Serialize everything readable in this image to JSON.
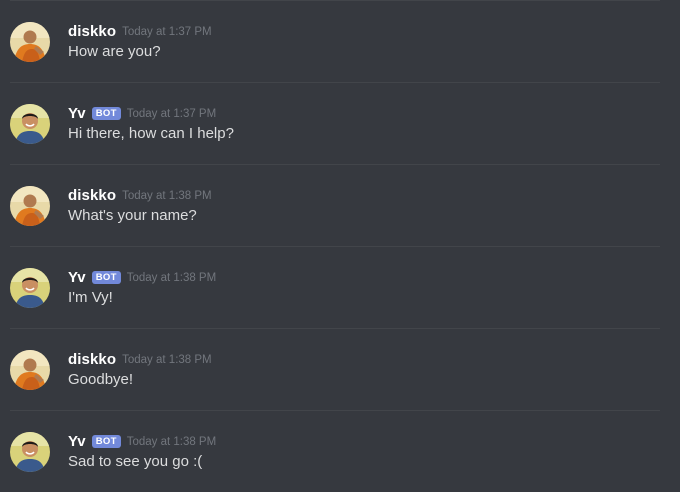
{
  "colors": {
    "background": "#36393f",
    "divider": "#42454a",
    "username": "#ffffff",
    "message_text": "#dcddde",
    "timestamp": "#72767d",
    "bot_tag": "#7289da"
  },
  "messages": [
    {
      "author": "diskko",
      "is_bot": false,
      "bot_tag": "",
      "timestamp": "Today at 1:37 PM",
      "text": "How are you?",
      "avatar_icon": "monk-avatar-icon"
    },
    {
      "author": "Yv",
      "is_bot": true,
      "bot_tag": "BOT",
      "timestamp": "Today at 1:37 PM",
      "text": "Hi there, how can I help?",
      "avatar_icon": "smiling-man-avatar-icon"
    },
    {
      "author": "diskko",
      "is_bot": false,
      "bot_tag": "",
      "timestamp": "Today at 1:38 PM",
      "text": "What's your name?",
      "avatar_icon": "monk-avatar-icon"
    },
    {
      "author": "Yv",
      "is_bot": true,
      "bot_tag": "BOT",
      "timestamp": "Today at 1:38 PM",
      "text": "I'm Vy!",
      "avatar_icon": "smiling-man-avatar-icon"
    },
    {
      "author": "diskko",
      "is_bot": false,
      "bot_tag": "",
      "timestamp": "Today at 1:38 PM",
      "text": "Goodbye!",
      "avatar_icon": "monk-avatar-icon"
    },
    {
      "author": "Yv",
      "is_bot": true,
      "bot_tag": "BOT",
      "timestamp": "Today at 1:38 PM",
      "text": "Sad to see you go :(",
      "avatar_icon": "smiling-man-avatar-icon"
    }
  ]
}
